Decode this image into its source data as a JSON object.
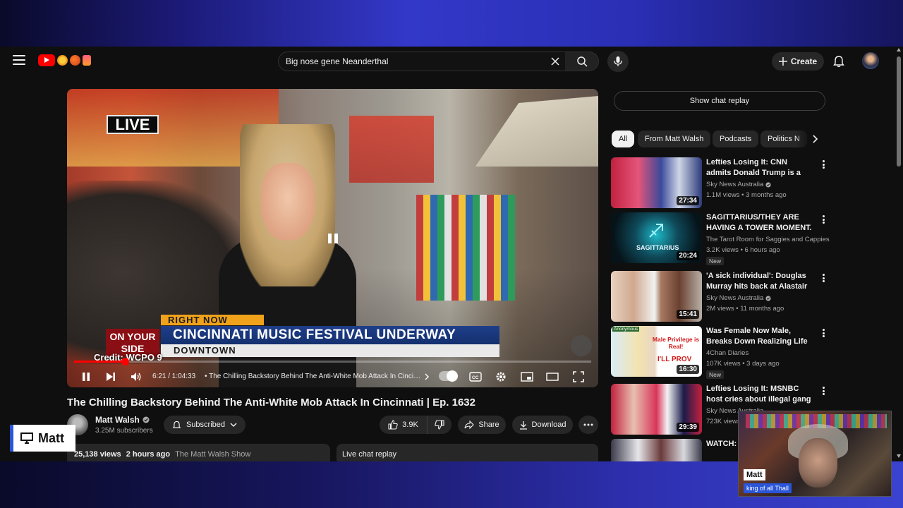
{
  "header": {
    "search_value": "Big nose gene Neanderthal",
    "create_label": "Create"
  },
  "player": {
    "overlay_live": "LIVE",
    "overlay_right_now": "RIGHT NOW",
    "overlay_headline": "CINCINNATI MUSIC FESTIVAL UNDERWAY",
    "overlay_subline": "DOWNTOWN",
    "overlay_on_your_side": "ON YOUR SIDE",
    "overlay_credit": "Credit: WCPO 9",
    "time_display": "6:21 / 1:04:33",
    "chapter_title": "The Chilling Backstory Behind The Anti-White Mob Attack In Cincinnati",
    "progress_fraction": 0.098
  },
  "video": {
    "title": "The Chilling Backstory Behind The Anti-White Mob Attack In Cincinnati | Ep. 1632",
    "channel_name": "Matt Walsh",
    "subscriber_count": "3.25M subscribers",
    "subscribed_label": "Subscribed",
    "like_count": "3.9K",
    "share_label": "Share",
    "download_label": "Download",
    "views": "25,138 views",
    "posted": "2 hours ago",
    "show_name": "The Matt Walsh Show",
    "live_chat_label": "Live chat replay"
  },
  "sidebar": {
    "show_chat_label": "Show chat replay",
    "chips": [
      "All",
      "From Matt Walsh",
      "Podcasts",
      "Politics N"
    ],
    "recommendations": [
      {
        "title": "Lefties Losing It: CNN admits Donald Trump is a 'soaring ...",
        "channel": "Sky News Australia",
        "verified": true,
        "meta": "1.1M views • 3 months ago",
        "duration": "27:34",
        "badge": ""
      },
      {
        "title": "SAGITTARIUS/THEY ARE HAVING A TOWER MOMENT. ...",
        "channel": "The Tarot Room for Saggies and Cappies",
        "verified": false,
        "meta": "3.2K views • 6 hours ago",
        "duration": "20:24",
        "badge": "New"
      },
      {
        "title": "'A sick individual': Douglas Murray hits back at Alastair ...",
        "channel": "Sky News Australia",
        "verified": true,
        "meta": "2M views • 11 months ago",
        "duration": "15:41",
        "badge": ""
      },
      {
        "title": "Was Female Now Male, Breaks Down Realizing Life Isn't Bette...",
        "channel": "4Chan Diaries",
        "verified": false,
        "meta": "107K views • 3 days ago",
        "duration": "16:30",
        "badge": "New"
      },
      {
        "title": "Lefties Losing It: MSNBC host cries about illegal gang ...",
        "channel": "Sky News Australia",
        "verified": true,
        "meta": "723K views",
        "duration": "29:39",
        "badge": ""
      },
      {
        "title": "WATCH: P... Delivers P...",
        "channel": "",
        "verified": false,
        "meta": "",
        "duration": "",
        "badge": ""
      }
    ],
    "thumb_texts": {
      "sagittarius": "SAGITTARIUS",
      "anonymous": "Anonymous",
      "male_privilege": "Male Privilege is Real!",
      "ill_prove": "I'LL PROV"
    }
  },
  "stream_overlay": {
    "name_tag": "Matt",
    "cam_name": "Matt",
    "cam_subtitle": "king of all Thall"
  },
  "colors": {
    "accent_red": "#ff0000",
    "overlay_blue": "#2a55d8",
    "app_bg": "#0f0f0f"
  }
}
